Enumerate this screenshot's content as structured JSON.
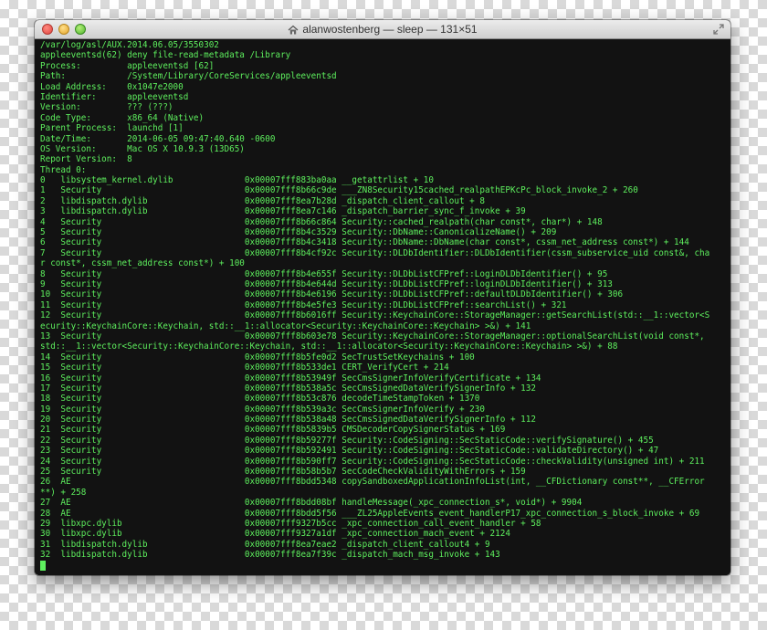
{
  "window": {
    "title": "alanwostenberg — sleep — 131×51"
  },
  "terminal": {
    "lines": [
      "/var/log/asl/AUX.2014.06.05/3550302",
      "appleeventsd(62) deny file-read-metadata /Library",
      "Process:         appleeventsd [62]",
      "Path:            /System/Library/CoreServices/appleeventsd",
      "Load Address:    0x1047e2000",
      "Identifier:      appleeventsd",
      "Version:         ??? (???)",
      "Code Type:       x86_64 (Native)",
      "Parent Process:  launchd [1]",
      "Date/Time:       2014-06-05 09:47:40.640 -0600",
      "OS Version:      Mac OS X 10.9.3 (13D65)",
      "Report Version:  8",
      "Thread 0:",
      "0   libsystem_kernel.dylib              0x00007fff883ba0aa __getattrlist + 10",
      "1   Security                            0x00007fff8b66c9de ___ZN8Security15cached_realpathEPKcPc_block_invoke_2 + 260",
      "2   libdispatch.dylib                   0x00007fff8ea7b28d _dispatch_client_callout + 8",
      "3   libdispatch.dylib                   0x00007fff8ea7c146 _dispatch_barrier_sync_f_invoke + 39",
      "4   Security                            0x00007fff8b66c864 Security::cached_realpath(char const*, char*) + 148",
      "5   Security                            0x00007fff8b4c3529 Security::DbName::CanonicalizeName() + 209",
      "6   Security                            0x00007fff8b4c3418 Security::DbName::DbName(char const*, cssm_net_address const*) + 144",
      "7   Security                            0x00007fff8b4cf92c Security::DLDbIdentifier::DLDbIdentifier(cssm_subservice_uid const&, cha",
      "r const*, cssm_net_address const*) + 100",
      "8   Security                            0x00007fff8b4e655f Security::DLDbListCFPref::LoginDLDbIdentifier() + 95",
      "9   Security                            0x00007fff8b4e644d Security::DLDbListCFPref::loginDLDbIdentifier() + 313",
      "10  Security                            0x00007fff8b4e6196 Security::DLDbListCFPref::defaultDLDbIdentifier() + 306",
      "11  Security                            0x00007fff8b4e5fe3 Security::DLDbListCFPref::searchList() + 321",
      "12  Security                            0x00007fff8b6016ff Security::KeychainCore::StorageManager::getSearchList(std::__1::vector<S",
      "ecurity::KeychainCore::Keychain, std::__1::allocator<Security::KeychainCore::Keychain> >&) + 141",
      "13  Security                            0x00007fff8b603e78 Security::KeychainCore::StorageManager::optionalSearchList(void const*,",
      "std::__1::vector<Security::KeychainCore::Keychain, std::__1::allocator<Security::KeychainCore::Keychain> >&) + 88",
      "14  Security                            0x00007fff8b5fe0d2 SecTrustSetKeychains + 100",
      "15  Security                            0x00007fff8b533de1 CERT_VerifyCert + 214",
      "16  Security                            0x00007fff8b53949f SecCmsSignerInfoVerifyCertificate + 134",
      "17  Security                            0x00007fff8b538a5c SecCmsSignedDataVerifySignerInfo + 132",
      "18  Security                            0x00007fff8b53c876 decodeTimeStampToken + 1370",
      "19  Security                            0x00007fff8b539a3c SecCmsSignerInfoVerify + 230",
      "20  Security                            0x00007fff8b538a48 SecCmsSignedDataVerifySignerInfo + 112",
      "21  Security                            0x00007fff8b5839b5 CMSDecoderCopySignerStatus + 169",
      "22  Security                            0x00007fff8b59277f Security::CodeSigning::SecStaticCode::verifySignature() + 455",
      "23  Security                            0x00007fff8b592491 Security::CodeSigning::SecStaticCode::validateDirectory() + 47",
      "24  Security                            0x00007fff8b590ff7 Security::CodeSigning::SecStaticCode::checkValidity(unsigned int) + 211",
      "25  Security                            0x00007fff8b58b5b7 SecCodeCheckValidityWithErrors + 159",
      "26  AE                                  0x00007fff8bdd5348 copySandboxedApplicationInfoList(int, __CFDictionary const**, __CFError",
      "**) + 258",
      "27  AE                                  0x00007fff8bdd08bf handleMessage(_xpc_connection_s*, void*) + 9904",
      "28  AE                                  0x00007fff8bdd5f56 ___ZL25AppleEvents_event_handlerP17_xpc_connection_s_block_invoke + 69",
      "29  libxpc.dylib                        0x00007fff9327b5cc _xpc_connection_call_event_handler + 58",
      "30  libxpc.dylib                        0x00007fff9327a1df _xpc_connection_mach_event + 2124",
      "31  libdispatch.dylib                   0x00007fff8ea7eae2 _dispatch_client_callout4 + 9",
      "32  libdispatch.dylib                   0x00007fff8ea7f39c _dispatch_mach_msg_invoke + 143"
    ]
  },
  "colors": {
    "terminal_background": "#121212",
    "terminal_text": "#5ef05e"
  },
  "icons": {
    "title_icon": "home-icon",
    "close": "close-button",
    "minimize": "minimize-button",
    "zoom": "zoom-button",
    "fullscreen": "fullscreen-icon"
  }
}
